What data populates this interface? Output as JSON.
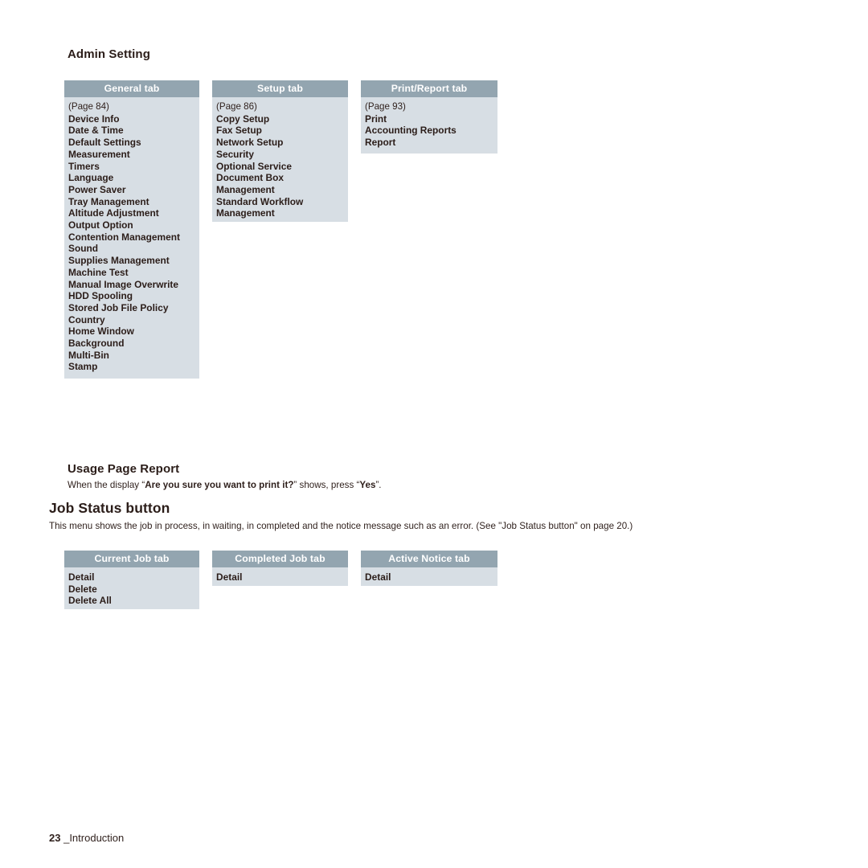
{
  "page": {
    "footer_page_number": "23",
    "footer_chapter": "_Introduction"
  },
  "admin_setting": {
    "title": "Admin Setting",
    "boxes": [
      {
        "header": "General tab",
        "page_ref": "(Page 84)",
        "items": [
          "Device Info",
          "Date & Time",
          "Default Settings",
          "Measurement",
          "Timers",
          "Language",
          "Power Saver",
          "Tray Management",
          "Altitude Adjustment",
          "Output Option",
          "Contention Management",
          "Sound",
          "Supplies Management",
          "Machine Test",
          "Manual Image Overwrite",
          "HDD Spooling",
          "Stored Job File Policy",
          "Country",
          "Home Window",
          "Background",
          "Multi-Bin",
          "Stamp"
        ]
      },
      {
        "header": "Setup tab",
        "page_ref": "(Page 86)",
        "items": [
          "Copy Setup",
          "Fax Setup",
          "Network Setup",
          "Security",
          "Optional Service",
          "Document Box",
          "Management",
          "Standard Workflow",
          "Management"
        ]
      },
      {
        "header": "Print/Report tab",
        "page_ref": "(Page 93)",
        "items": [
          "Print",
          "Accounting Reports",
          "Report"
        ]
      }
    ]
  },
  "usage_page_report": {
    "title": "Usage Page Report",
    "body_prefix": "When the display “",
    "body_bold_1": "Are you sure you want to print it?",
    "body_middle": "” shows, press “",
    "body_bold_2": "Yes",
    "body_suffix": "”."
  },
  "job_status": {
    "title": "Job Status button",
    "body": "This menu shows the job in process, in waiting, in completed and the notice message such as an error. (See \"Job Status button\" on page 20.)",
    "boxes": [
      {
        "header": "Current Job tab",
        "items": [
          "Detail",
          "Delete",
          "Delete All"
        ]
      },
      {
        "header": "Completed Job tab",
        "items": [
          "Detail"
        ]
      },
      {
        "header": "Active Notice tab",
        "items": [
          "Detail"
        ]
      }
    ]
  },
  "colors": {
    "header_bar": "#93a5b0",
    "box_body": "#d7dee4",
    "text": "#2e1f1b",
    "page_background": "#ffffff"
  }
}
